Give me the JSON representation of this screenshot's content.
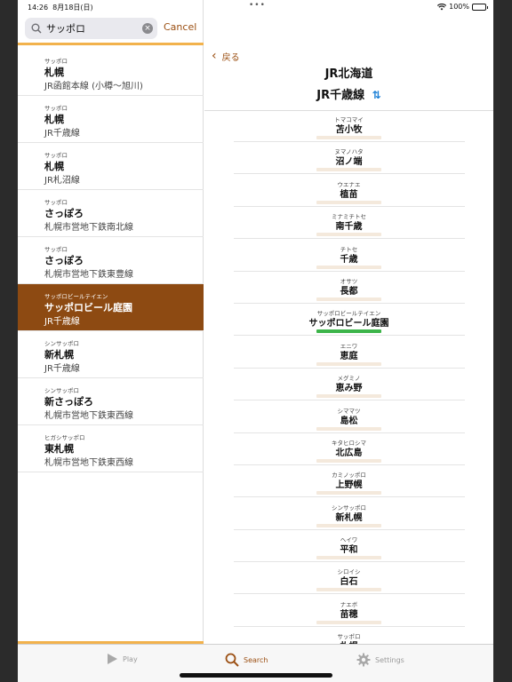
{
  "status": {
    "time": "14:26",
    "date": "8月18日(日)",
    "battery": "100%"
  },
  "search": {
    "value": "サッポロ",
    "placeholder": "",
    "cancel_label": "Cancel"
  },
  "results": [
    {
      "kana": "サッポロ",
      "name": "札幌",
      "line": "JR函館本線 (小樽〜旭川)",
      "selected": false
    },
    {
      "kana": "サッポロ",
      "name": "札幌",
      "line": "JR千歳線",
      "selected": false
    },
    {
      "kana": "サッポロ",
      "name": "札幌",
      "line": "JR札沼線",
      "selected": false
    },
    {
      "kana": "サッポロ",
      "name": "さっぽろ",
      "line": "札幌市営地下鉄南北線",
      "selected": false
    },
    {
      "kana": "サッポロ",
      "name": "さっぽろ",
      "line": "札幌市営地下鉄東豊線",
      "selected": false
    },
    {
      "kana": "サッポロビールテイエン",
      "name": "サッポロビール庭園",
      "line": "JR千歳線",
      "selected": true
    },
    {
      "kana": "シンサッポロ",
      "name": "新札幌",
      "line": "JR千歳線",
      "selected": false
    },
    {
      "kana": "シンサッポロ",
      "name": "新さっぽろ",
      "line": "札幌市営地下鉄東西線",
      "selected": false
    },
    {
      "kana": "ヒガシサッポロ",
      "name": "東札幌",
      "line": "札幌市営地下鉄東西線",
      "selected": false
    }
  ],
  "detail": {
    "back_label": "戻る",
    "company": "JR北海道",
    "line": "JR千歳線",
    "stations": [
      {
        "kana": "トマコマイ",
        "name": "苫小牧",
        "current": false
      },
      {
        "kana": "ヌマノハタ",
        "name": "沼ノ端",
        "current": false
      },
      {
        "kana": "ウエナエ",
        "name": "植苗",
        "current": false
      },
      {
        "kana": "ミナミチトセ",
        "name": "南千歳",
        "current": false
      },
      {
        "kana": "チトセ",
        "name": "千歳",
        "current": false
      },
      {
        "kana": "オサツ",
        "name": "長都",
        "current": false
      },
      {
        "kana": "サッポロビールテイエン",
        "name": "サッポロビール庭園",
        "current": true
      },
      {
        "kana": "エニワ",
        "name": "恵庭",
        "current": false
      },
      {
        "kana": "メグミノ",
        "name": "恵み野",
        "current": false
      },
      {
        "kana": "シママツ",
        "name": "島松",
        "current": false
      },
      {
        "kana": "キタヒロシマ",
        "name": "北広島",
        "current": false
      },
      {
        "kana": "カミノッポロ",
        "name": "上野幌",
        "current": false
      },
      {
        "kana": "シンサッポロ",
        "name": "新札幌",
        "current": false
      },
      {
        "kana": "ヘイワ",
        "name": "平和",
        "current": false
      },
      {
        "kana": "シロイシ",
        "name": "白石",
        "current": false
      },
      {
        "kana": "ナエボ",
        "name": "苗穂",
        "current": false
      },
      {
        "kana": "サッポロ",
        "name": "札幌",
        "current": false
      }
    ]
  },
  "tabs": [
    {
      "label": "Play",
      "icon": "play-icon",
      "active": false
    },
    {
      "label": "Search",
      "icon": "search-icon",
      "active": true
    },
    {
      "label": "Settings",
      "icon": "gear-icon",
      "active": false
    }
  ],
  "colors": {
    "accent": "#9b4f12",
    "selected_row": "#8d4a12",
    "highlight_bar": "#f2b24c",
    "current_station": "#3cb449",
    "swap_icon": "#1a7fd6"
  }
}
